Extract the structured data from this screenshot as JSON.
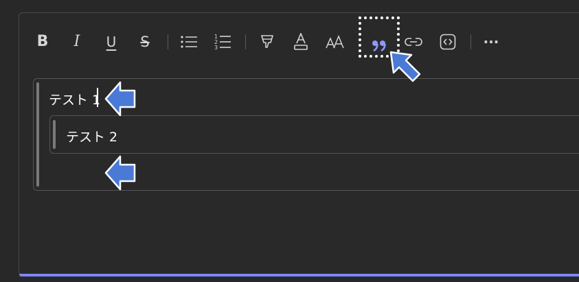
{
  "toolbar": {
    "bold_glyph": "B",
    "italic_glyph": "I",
    "underline_glyph": "U",
    "strike_glyph": "S",
    "more_glyph": "···",
    "buttons": [
      {
        "id": "bold",
        "icon": "bold-icon"
      },
      {
        "id": "italic",
        "icon": "italic-icon"
      },
      {
        "id": "underline",
        "icon": "underline-icon"
      },
      {
        "id": "strikethrough",
        "icon": "strikethrough-icon"
      },
      {
        "id": "bulleted-list",
        "icon": "bulleted-list-icon"
      },
      {
        "id": "numbered-list",
        "icon": "numbered-list-icon"
      },
      {
        "id": "highlight",
        "icon": "highlight-icon"
      },
      {
        "id": "font-color",
        "icon": "font-color-icon"
      },
      {
        "id": "font-size",
        "icon": "font-size-icon"
      },
      {
        "id": "quote",
        "icon": "quote-icon",
        "highlighted": true
      },
      {
        "id": "link",
        "icon": "link-icon"
      },
      {
        "id": "code-snippet",
        "icon": "code-snippet-icon"
      },
      {
        "id": "more-options",
        "icon": "more-icon"
      }
    ]
  },
  "editor": {
    "outer_quote_text": "テスト 1",
    "inner_quote_text": "テスト 2"
  },
  "colors": {
    "background": "#282828",
    "icon": "#d6d6d6",
    "accent": "#7f85f5",
    "quote_icon": "#8f96ff",
    "annotation_arrow": "#4a7ad6"
  }
}
